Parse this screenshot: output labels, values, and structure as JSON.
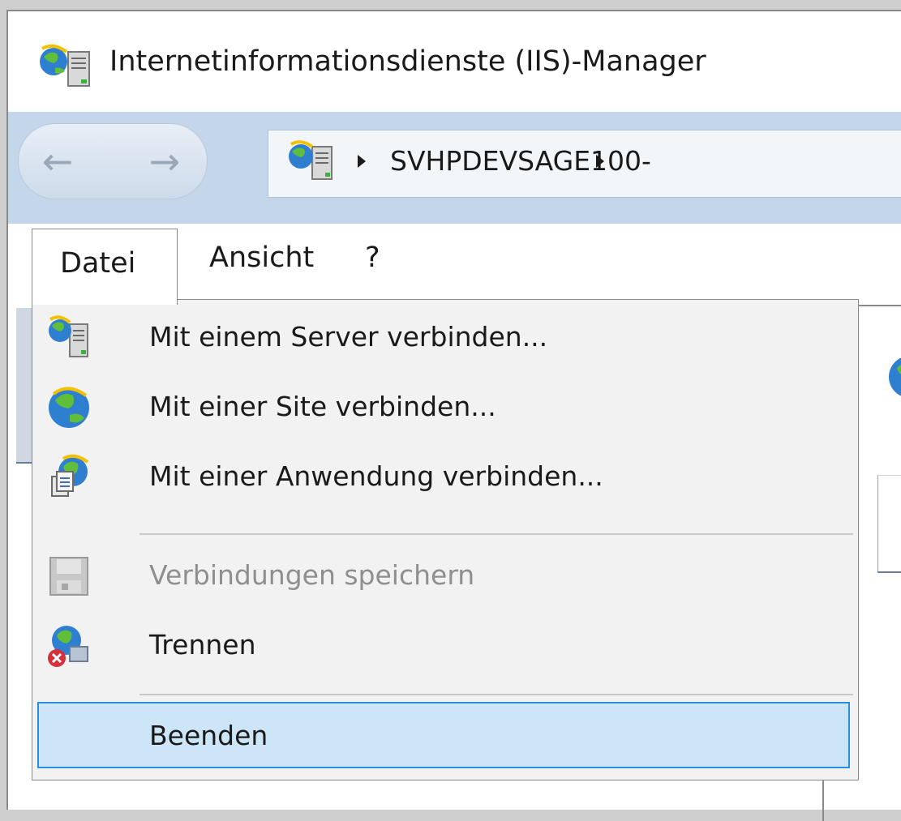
{
  "window": {
    "title": "Internetinformationsdienste (IIS)-Manager"
  },
  "navigation": {
    "back_icon": "back-arrow-icon",
    "forward_icon": "forward-arrow-icon",
    "address": {
      "server": "SVHPDEVSAGE100-"
    }
  },
  "menubar": {
    "items": [
      {
        "label": "Datei",
        "open": true
      },
      {
        "label": "Ansicht"
      },
      {
        "label": "?"
      }
    ]
  },
  "dropdown": {
    "items": [
      {
        "label": "Mit einem Server verbinden...",
        "icon": "server-connect-icon",
        "enabled": true
      },
      {
        "label": "Mit einer Site verbinden...",
        "icon": "globe-icon",
        "enabled": true
      },
      {
        "label": "Mit einer Anwendung verbinden...",
        "icon": "application-globe-icon",
        "enabled": true
      },
      {
        "label": "Verbindungen speichern",
        "icon": "floppy-disk-icon",
        "enabled": false
      },
      {
        "label": "Trennen",
        "icon": "disconnect-icon",
        "enabled": true
      },
      {
        "label": "Beenden",
        "icon": "",
        "enabled": true,
        "highlighted": true
      }
    ]
  },
  "colors": {
    "nav_background": "#c4d7ea",
    "highlight_fill": "#cde6f7",
    "highlight_border": "#2b8de0",
    "disabled_text": "#8f8f8f"
  }
}
